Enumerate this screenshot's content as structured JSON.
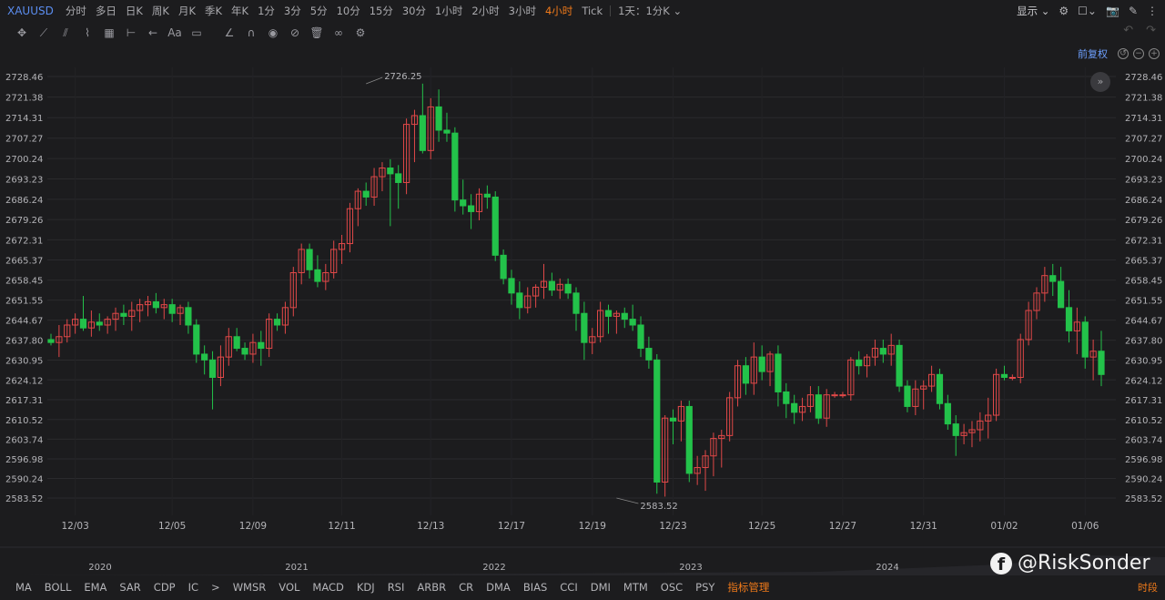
{
  "symbol": "XAUUSD",
  "periods": [
    "分时",
    "多日",
    "日K",
    "周K",
    "月K",
    "季K",
    "年K",
    "1分",
    "3分",
    "5分",
    "10分",
    "15分",
    "30分",
    "1小时",
    "2小时",
    "3小时",
    "4小时",
    "Tick",
    "1天：1分K"
  ],
  "active_period": "4小时",
  "topright": {
    "show_label": "显示"
  },
  "price_adjust_label": "前复权",
  "indicators": [
    "MA",
    "BOLL",
    "EMA",
    "SAR",
    "CDP",
    "IC",
    "WMSR",
    "VOL",
    "MACD",
    "KDJ",
    "RSI",
    "ARBR",
    "CR",
    "DMA",
    "BIAS",
    "CCI",
    "DMI",
    "MTM",
    "OSC",
    "PSY"
  ],
  "indicator_manage_label": "指标管理",
  "time_segment_label": "时段",
  "watermark": "@RiskSonder",
  "colors": {
    "up": "#e04848",
    "down": "#23c24a",
    "background": "#1c1c1e",
    "grid": "#2a2a2d",
    "accent": "#f07a1a"
  },
  "chart_data": {
    "type": "candlestick",
    "y_ticks": [
      "2728.46",
      "2721.38",
      "2714.31",
      "2707.27",
      "2700.24",
      "2693.23",
      "2686.24",
      "2679.26",
      "2672.31",
      "2665.37",
      "2658.45",
      "2651.55",
      "2644.67",
      "2637.80",
      "2630.95",
      "2624.12",
      "2617.31",
      "2610.52",
      "2603.74",
      "2596.98",
      "2590.24",
      "2583.52"
    ],
    "ylim": [
      2583.52,
      2728.46
    ],
    "x_ticks": [
      "12/03",
      "12/05",
      "12/09",
      "12/11",
      "12/13",
      "12/17",
      "12/19",
      "12/23",
      "12/25",
      "12/27",
      "12/31",
      "01/02",
      "01/06"
    ],
    "x_tick_index": [
      3,
      15,
      25,
      36,
      47,
      57,
      67,
      77,
      88,
      98,
      108,
      118,
      128
    ],
    "overview_years": [
      "2020",
      "2021",
      "2022",
      "2023",
      "2024"
    ],
    "high_label": "2726.25",
    "low_label": "2583.52",
    "high_index": 39,
    "low_index": 70,
    "candles": [
      [
        2638,
        2640,
        2636,
        2637
      ],
      [
        2637,
        2643,
        2632,
        2639
      ],
      [
        2639,
        2645,
        2637,
        2643
      ],
      [
        2643,
        2647,
        2640,
        2645
      ],
      [
        2645,
        2653,
        2641,
        2642
      ],
      [
        2642,
        2648,
        2639,
        2644
      ],
      [
        2644,
        2647,
        2641,
        2643
      ],
      [
        2643,
        2646,
        2640,
        2645
      ],
      [
        2645,
        2649,
        2641,
        2647
      ],
      [
        2647,
        2650,
        2643,
        2646
      ],
      [
        2646,
        2651,
        2641,
        2648
      ],
      [
        2648,
        2652,
        2644,
        2650
      ],
      [
        2650,
        2653,
        2646,
        2651
      ],
      [
        2651,
        2654,
        2647,
        2649
      ],
      [
        2649,
        2652,
        2645,
        2650
      ],
      [
        2650,
        2652,
        2644,
        2647
      ],
      [
        2647,
        2650,
        2643,
        2649
      ],
      [
        2649,
        2651,
        2640,
        2643
      ],
      [
        2643,
        2645,
        2630,
        2633
      ],
      [
        2633,
        2636,
        2626,
        2631
      ],
      [
        2631,
        2634,
        2614,
        2625
      ],
      [
        2625,
        2636,
        2622,
        2632
      ],
      [
        2632,
        2642,
        2629,
        2639
      ],
      [
        2639,
        2642,
        2634,
        2635
      ],
      [
        2635,
        2637,
        2631,
        2633
      ],
      [
        2633,
        2640,
        2630,
        2637
      ],
      [
        2637,
        2641,
        2629,
        2635
      ],
      [
        2635,
        2647,
        2632,
        2645
      ],
      [
        2645,
        2647,
        2641,
        2643
      ],
      [
        2643,
        2651,
        2640,
        2649
      ],
      [
        2649,
        2663,
        2646,
        2661
      ],
      [
        2661,
        2671,
        2657,
        2669
      ],
      [
        2669,
        2671,
        2659,
        2662
      ],
      [
        2662,
        2667,
        2656,
        2658
      ],
      [
        2658,
        2664,
        2655,
        2661
      ],
      [
        2661,
        2672,
        2659,
        2669
      ],
      [
        2669,
        2674,
        2664,
        2671
      ],
      [
        2671,
        2685,
        2668,
        2683
      ],
      [
        2683,
        2690,
        2677,
        2689
      ],
      [
        2689,
        2692,
        2684,
        2687
      ],
      [
        2687,
        2697,
        2684,
        2694
      ],
      [
        2694,
        2699,
        2689,
        2697
      ],
      [
        2697,
        2700,
        2677,
        2695
      ],
      [
        2695,
        2698,
        2683,
        2692
      ],
      [
        2692,
        2714,
        2688,
        2712
      ],
      [
        2712,
        2717,
        2699,
        2715
      ],
      [
        2715,
        2726,
        2702,
        2703
      ],
      [
        2703,
        2721,
        2700,
        2718
      ],
      [
        2718,
        2724,
        2706,
        2710
      ],
      [
        2710,
        2716,
        2706,
        2709
      ],
      [
        2709,
        2711,
        2682,
        2686
      ],
      [
        2686,
        2693,
        2681,
        2684
      ],
      [
        2684,
        2688,
        2676,
        2682
      ],
      [
        2682,
        2690,
        2679,
        2688
      ],
      [
        2688,
        2691,
        2683,
        2687
      ],
      [
        2687,
        2689,
        2665,
        2667
      ],
      [
        2667,
        2669,
        2657,
        2659
      ],
      [
        2659,
        2662,
        2650,
        2654
      ],
      [
        2654,
        2658,
        2645,
        2649
      ],
      [
        2649,
        2656,
        2647,
        2653
      ],
      [
        2653,
        2657,
        2649,
        2656
      ],
      [
        2656,
        2664,
        2652,
        2658
      ],
      [
        2658,
        2661,
        2653,
        2655
      ],
      [
        2655,
        2659,
        2652,
        2657
      ],
      [
        2657,
        2659,
        2652,
        2654
      ],
      [
        2654,
        2656,
        2641,
        2647
      ],
      [
        2647,
        2651,
        2631,
        2637
      ],
      [
        2637,
        2642,
        2633,
        2639
      ],
      [
        2639,
        2651,
        2637,
        2648
      ],
      [
        2648,
        2650,
        2640,
        2646
      ],
      [
        2646,
        2648,
        2640,
        2647
      ],
      [
        2647,
        2649,
        2642,
        2645
      ],
      [
        2645,
        2650,
        2641,
        2643
      ],
      [
        2643,
        2646,
        2632,
        2635
      ],
      [
        2635,
        2639,
        2628,
        2631
      ]
    ],
    "candles_b": [
      [
        2631,
        2633,
        2585,
        2589
      ],
      [
        2589,
        2612,
        2584,
        2611
      ],
      [
        2611,
        2614,
        2602,
        2610
      ],
      [
        2610,
        2617,
        2603,
        2615
      ],
      [
        2615,
        2617,
        2589,
        2592
      ],
      [
        2592,
        2598,
        2588,
        2594
      ],
      [
        2594,
        2600,
        2586,
        2598
      ],
      [
        2598,
        2606,
        2591,
        2604
      ],
      [
        2604,
        2607,
        2594,
        2605
      ],
      [
        2605,
        2620,
        2603,
        2618
      ],
      [
        2618,
        2631,
        2615,
        2629
      ],
      [
        2629,
        2632,
        2619,
        2623
      ],
      [
        2623,
        2637,
        2619,
        2632
      ],
      [
        2632,
        2636,
        2624,
        2627
      ],
      [
        2627,
        2634,
        2622,
        2633
      ],
      [
        2633,
        2636,
        2615,
        2620
      ],
      [
        2620,
        2623,
        2611,
        2616
      ],
      [
        2616,
        2619,
        2609,
        2613
      ],
      [
        2613,
        2618,
        2610,
        2615
      ],
      [
        2615,
        2622,
        2613,
        2619
      ],
      [
        2619,
        2622,
        2609,
        2611
      ],
      [
        2611,
        2621,
        2608,
        2619
      ],
      [
        2619,
        2620,
        2618,
        2619
      ],
      [
        2619,
        2620,
        2618,
        2619
      ],
      [
        2619,
        2632,
        2617,
        2631
      ],
      [
        2631,
        2634,
        2626,
        2629
      ],
      [
        2629,
        2633,
        2625,
        2632
      ],
      [
        2632,
        2638,
        2629,
        2635
      ],
      [
        2635,
        2638,
        2630,
        2633
      ],
      [
        2633,
        2640,
        2629,
        2636
      ],
      [
        2636,
        2638,
        2620,
        2622
      ],
      [
        2622,
        2624,
        2613,
        2615
      ],
      [
        2615,
        2624,
        2612,
        2621
      ],
      [
        2621,
        2624,
        2614,
        2622
      ],
      [
        2622,
        2629,
        2620,
        2626
      ],
      [
        2626,
        2628,
        2614,
        2616
      ],
      [
        2616,
        2619,
        2607,
        2609
      ],
      [
        2609,
        2612,
        2598,
        2605
      ],
      [
        2605,
        2609,
        2602,
        2606
      ],
      [
        2606,
        2610,
        2601,
        2607
      ],
      [
        2607,
        2613,
        2603,
        2610
      ],
      [
        2610,
        2618,
        2604,
        2612
      ],
      [
        2612,
        2628,
        2610,
        2626
      ],
      [
        2626,
        2629,
        2624,
        2625
      ],
      [
        2625,
        2626,
        2624,
        2625
      ],
      [
        2625,
        2640,
        2623,
        2638
      ],
      [
        2638,
        2651,
        2636,
        2648
      ],
      [
        2648,
        2656,
        2645,
        2654
      ],
      [
        2654,
        2663,
        2651,
        2660
      ],
      [
        2660,
        2664,
        2653,
        2658
      ],
      [
        2658,
        2663,
        2652,
        2649
      ],
      [
        2649,
        2655,
        2637,
        2641
      ],
      [
        2641,
        2649,
        2633,
        2644
      ],
      [
        2644,
        2646,
        2628,
        2632
      ],
      [
        2632,
        2638,
        2624,
        2634
      ],
      [
        2634,
        2641,
        2622,
        2626
      ]
    ]
  }
}
